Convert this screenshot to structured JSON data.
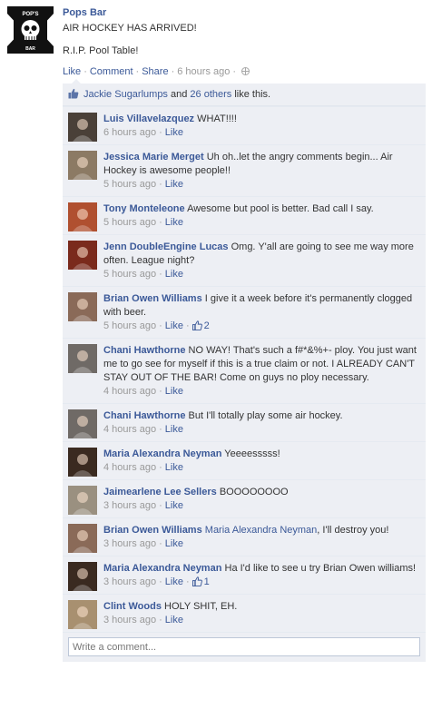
{
  "post": {
    "page_name": "Pops Bar",
    "logo_text": "POP'S",
    "logo_subtext": "BAR",
    "lines": [
      "AIR HOCKEY HAS ARRIVED!",
      "",
      "R.I.P. Pool Table!"
    ],
    "actions": {
      "like": "Like",
      "comment": "Comment",
      "share": "Share",
      "time": "6 hours ago"
    }
  },
  "likes": {
    "first_name": "Jackie Sugarlumps",
    "and_text": "and",
    "others": "26 others",
    "suffix": "like this."
  },
  "comments": [
    {
      "author": "Luis Villavelazquez",
      "text": "WHAT!!!!",
      "time": "6 hours ago",
      "like": "Like",
      "avatar_color": "#4a4038"
    },
    {
      "author": "Jessica Marie Merget",
      "text": "Uh oh..let the angry comments begin... Air Hockey is awesome people!!",
      "time": "5 hours ago",
      "like": "Like",
      "avatar_color": "#8c7a64"
    },
    {
      "author": "Tony Monteleone",
      "text": "Awesome but pool is better. Bad call I say.",
      "time": "5 hours ago",
      "like": "Like",
      "avatar_color": "#b05030"
    },
    {
      "author": "Jenn DoubleEngine Lucas",
      "text": "Omg. Y'all are going to see me way more often. League night?",
      "time": "5 hours ago",
      "like": "Like",
      "avatar_color": "#7a2a1c"
    },
    {
      "author": "Brian Owen Williams",
      "text": "I give it a week before it's permanently clogged with beer.",
      "time": "5 hours ago",
      "like": "Like",
      "likes_count": "2",
      "avatar_color": "#8a6a58"
    },
    {
      "author": "Chani Hawthorne",
      "text": "NO WAY! That's such a f#*&%+- ploy. You just want me to go see for myself if this is a true claim or not. I ALREADY CAN'T STAY OUT OF THE BAR! Come on guys no ploy necessary.",
      "time": "4 hours ago",
      "like": "Like",
      "avatar_color": "#6f6a66"
    },
    {
      "author": "Chani Hawthorne",
      "text": "But I'll totally play some air hockey.",
      "time": "4 hours ago",
      "like": "Like",
      "avatar_color": "#6f6a66"
    },
    {
      "author": "Maria Alexandra Neyman",
      "text": "Yeeeesssss!",
      "time": "4 hours ago",
      "like": "Like",
      "avatar_color": "#3a2a20"
    },
    {
      "author": "Jaimearlene Lee Sellers",
      "text": "BOOOOOOOO",
      "time": "3 hours ago",
      "like": "Like",
      "avatar_color": "#9a9080"
    },
    {
      "author": "Brian Owen Williams",
      "mention": "Maria Alexandra Neyman",
      "text": ", I'll destroy you!",
      "time": "3 hours ago",
      "like": "Like",
      "avatar_color": "#8a6a58"
    },
    {
      "author": "Maria Alexandra Neyman",
      "text": "Ha I'd like to see u try Brian Owen williams!",
      "time": "3 hours ago",
      "like": "Like",
      "likes_count": "1",
      "avatar_color": "#3a2a20"
    },
    {
      "author": "Clint Woods",
      "text": "HOLY SHIT, EH.",
      "time": "3 hours ago",
      "like": "Like",
      "avatar_color": "#a89070"
    }
  ],
  "write_comment": {
    "placeholder": "Write a comment..."
  },
  "colors": {
    "link": "#3b5998",
    "ufi_bg": "#edeff4",
    "meta": "#999999"
  }
}
